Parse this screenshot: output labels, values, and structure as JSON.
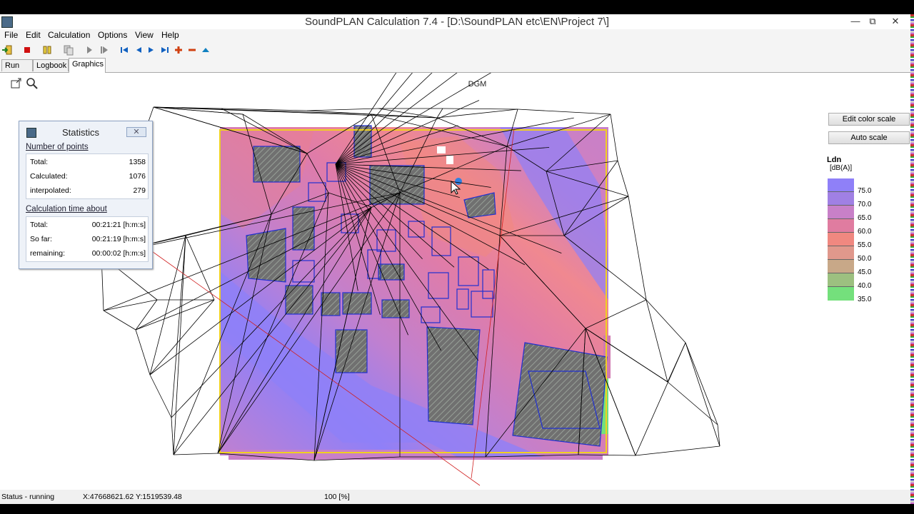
{
  "window": {
    "title": "SoundPLAN Calculation 7.4 - [D:\\SoundPLAN etc\\EN\\Project 7\\]",
    "minimize": "—",
    "restore": "⧉",
    "close": "✕"
  },
  "menu": [
    "File",
    "Edit",
    "Calculation",
    "Options",
    "View",
    "Help"
  ],
  "tabs": [
    "Run file",
    "Logbook",
    "Graphics"
  ],
  "active_tab": "Graphics",
  "canvas": {
    "label": "DGM",
    "edit_color_scale": "Edit color scale",
    "auto_scale": "Auto scale"
  },
  "legend": {
    "title": "Ldn",
    "unit": "[dB(A)]",
    "levels": [
      {
        "label": "75.0",
        "color": "#8f80f8"
      },
      {
        "label": "70.0",
        "color": "#a080e4"
      },
      {
        "label": "65.0",
        "color": "#c880c8"
      },
      {
        "label": "60.0",
        "color": "#e07ca0"
      },
      {
        "label": "55.0",
        "color": "#f08880"
      },
      {
        "label": "50.0",
        "color": "#e0988c"
      },
      {
        "label": "45.0",
        "color": "#c8a888"
      },
      {
        "label": "40.0",
        "color": "#9cc080"
      },
      {
        "label": "35.0",
        "color": "#74e07c"
      }
    ]
  },
  "statistics": {
    "title": "Statistics",
    "close": "✕",
    "points_title": "Number of points",
    "points": [
      {
        "label": "Total:",
        "value": "1358"
      },
      {
        "label": "Calculated:",
        "value": "1076"
      },
      {
        "label": "interpolated:",
        "value": "279"
      }
    ],
    "time_title": "Calculation time about",
    "times": [
      {
        "label": "Total:",
        "value": "00:21:21 [h:m:s]"
      },
      {
        "label": "So far:",
        "value": "00:21:19 [h:m:s]"
      },
      {
        "label": "remaining:",
        "value": "00:00:02 [h:m:s]"
      }
    ]
  },
  "status": {
    "state": "Status - running",
    "coords": "X:47668621.62  Y:1519539.48",
    "progress": "100 [%]",
    "progress_value": 100
  },
  "colors": {
    "noise_high": "#8f80f8",
    "noise_mid": "#e07ca0",
    "noise_low": "#74e07c",
    "building_outline": "#2030d0",
    "calc_area": "#f0d020",
    "triangulation": "#000000"
  },
  "icons": [
    "app-icon",
    "exit-icon",
    "stop-icon",
    "pause-icon",
    "copy-icon",
    "play-icon",
    "fast-forward-icon",
    "first-icon",
    "prev-icon",
    "next-icon",
    "last-icon",
    "plus-icon",
    "minus-icon",
    "up-icon",
    "export-icon",
    "zoom-icon"
  ]
}
